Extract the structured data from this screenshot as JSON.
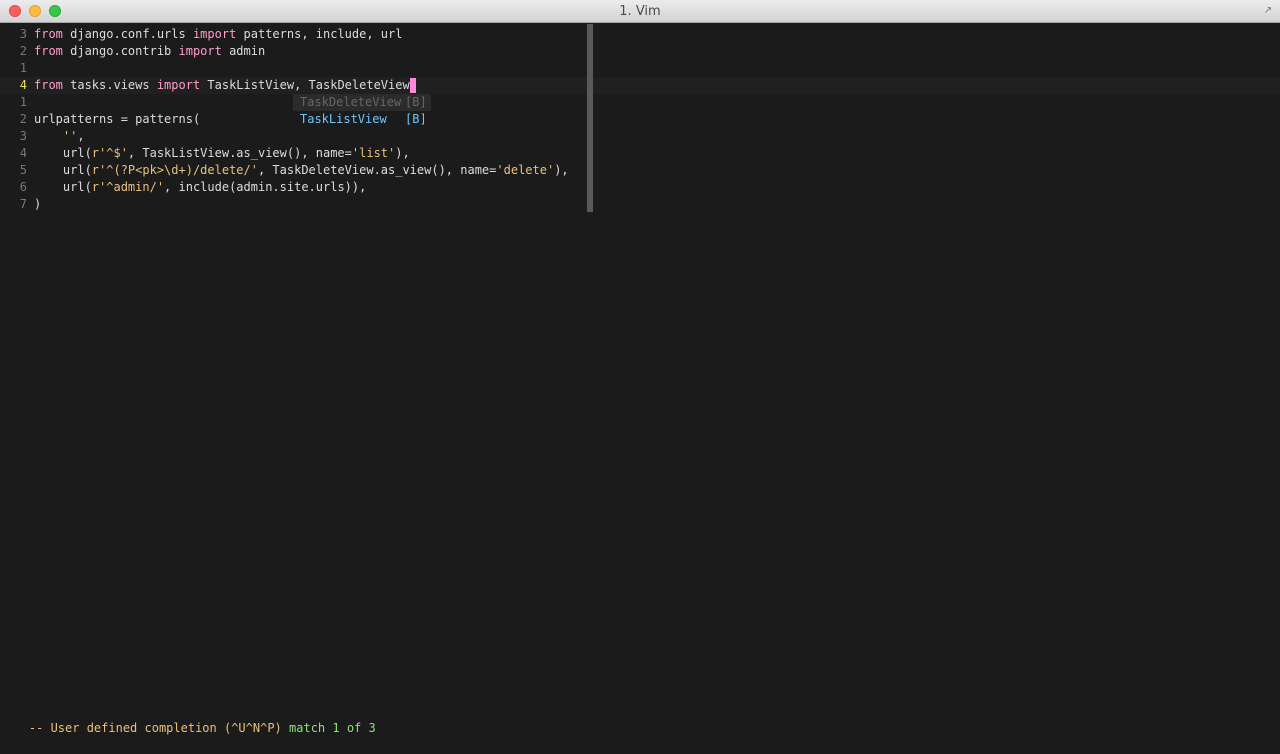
{
  "window": {
    "title": "1. Vim",
    "fullscreen_icon": "↗"
  },
  "editor": {
    "lines": [
      {
        "num": "3",
        "parts": [
          [
            "kw",
            "from"
          ],
          [
            "t",
            " django.conf.urls "
          ],
          [
            "kw",
            "import"
          ],
          [
            "t",
            " patterns, include, url"
          ]
        ]
      },
      {
        "num": "2",
        "parts": [
          [
            "kw",
            "from"
          ],
          [
            "t",
            " django.contrib "
          ],
          [
            "kw",
            "import"
          ],
          [
            "t",
            " admin"
          ]
        ]
      },
      {
        "num": "1",
        "parts": []
      },
      {
        "num": "4",
        "current": true,
        "parts": [
          [
            "kw",
            "from"
          ],
          [
            "t",
            " tasks.views "
          ],
          [
            "kw",
            "import"
          ],
          [
            "t",
            " TaskListView, TaskDeleteView"
          ]
        ]
      },
      {
        "num": "1",
        "parts": []
      },
      {
        "num": "2",
        "parts": [
          [
            "t",
            "urlpatterns = patterns("
          ]
        ]
      },
      {
        "num": "3",
        "parts": [
          [
            "t",
            "    "
          ],
          [
            "str",
            "''"
          ],
          [
            "t",
            ","
          ]
        ]
      },
      {
        "num": "4",
        "parts": [
          [
            "t",
            "    url("
          ],
          [
            "str",
            "r'^$'"
          ],
          [
            "t",
            ", TaskListView.as_view(), name="
          ],
          [
            "str",
            "'list'"
          ],
          [
            "t",
            "),"
          ]
        ]
      },
      {
        "num": "5",
        "parts": [
          [
            "t",
            "    url("
          ],
          [
            "str",
            "r'^(?P<pk>\\d+)/delete/'"
          ],
          [
            "t",
            ", TaskDeleteView.as_view(), name="
          ],
          [
            "str",
            "'delete'"
          ],
          [
            "t",
            "),"
          ]
        ]
      },
      {
        "num": "6",
        "parts": [
          [
            "t",
            "    url("
          ],
          [
            "str",
            "r'^admin/'"
          ],
          [
            "t",
            ", include(admin.site.urls)),"
          ]
        ]
      },
      {
        "num": "7",
        "parts": [
          [
            "t",
            ")"
          ]
        ]
      }
    ]
  },
  "completion": {
    "items": [
      {
        "word": "TaskDeleteView",
        "menu": "[B]",
        "selected": true
      },
      {
        "word": "TaskListView",
        "menu": "[B]",
        "selected": false
      }
    ]
  },
  "statusline": {
    "mode_text": "-- User defined completion (^U^N^P)",
    "match_text": "match 1 of 3"
  },
  "colors": {
    "background": "#1b1b1b",
    "keyword": "#ff9ecd",
    "string": "#e8c07a",
    "cursor": "#ff88d8",
    "current_line_number": "#e8e05a",
    "completion_item": "#6ec6ff",
    "match_text": "#8fe07a"
  }
}
